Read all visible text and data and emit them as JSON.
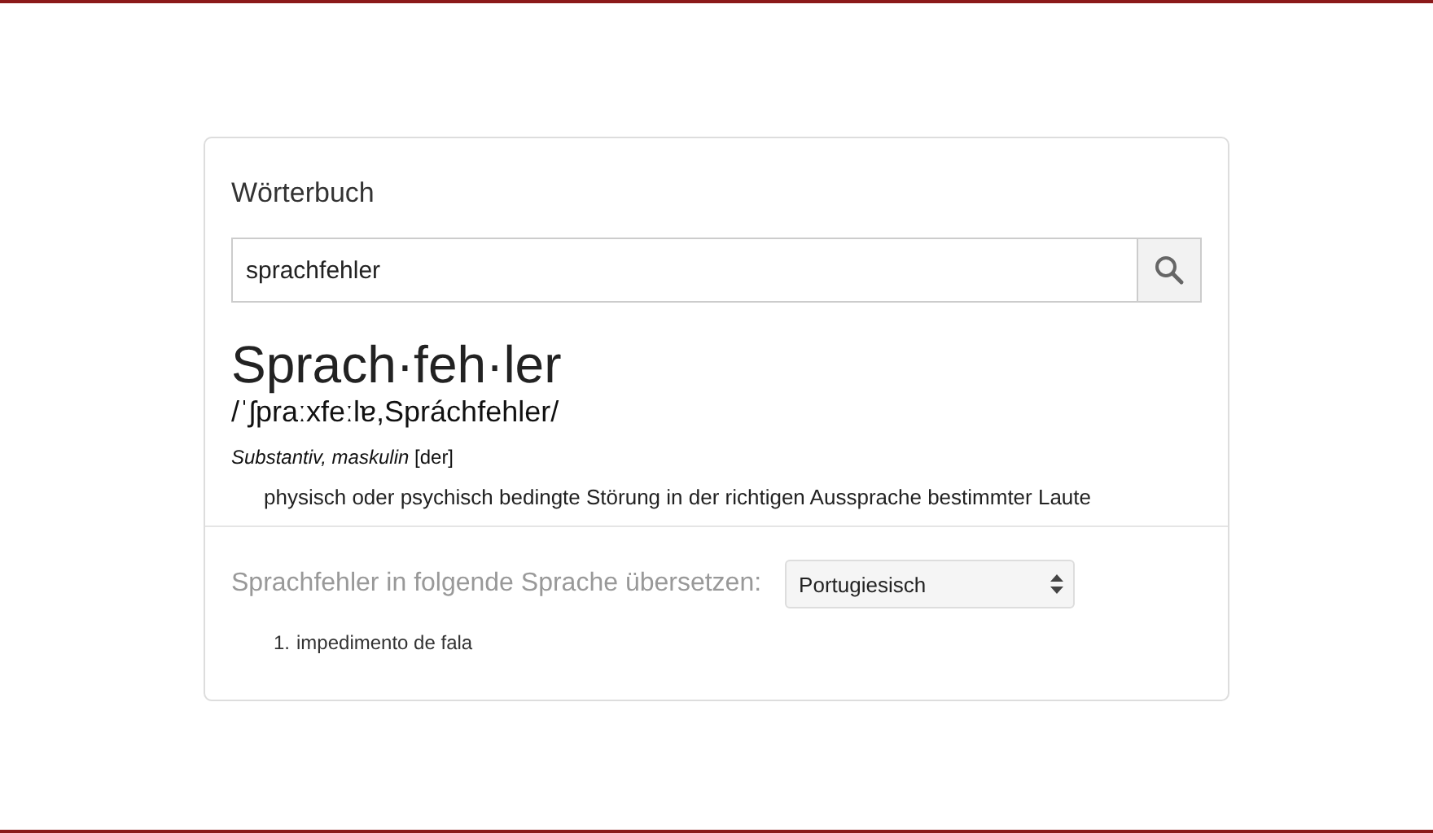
{
  "heading": "Wörterbuch",
  "search": {
    "value": "sprachfehler"
  },
  "entry": {
    "headword": "Sprach·feh·ler",
    "pronunciation": "/ˈʃpraːxfeːlɐ,Spráchfehler/",
    "grammar": "*Substantiv, maskulin* [der]",
    "definition": "physisch oder psychisch bedingte Störung in der richtigen Aussprache bestimmter Laute"
  },
  "translate": {
    "label": "Sprachfehler in folgende Sprache übersetzen:",
    "language": "Portugiesisch",
    "results": [
      {
        "number": "1.",
        "text": "impedimento de fala"
      }
    ]
  }
}
